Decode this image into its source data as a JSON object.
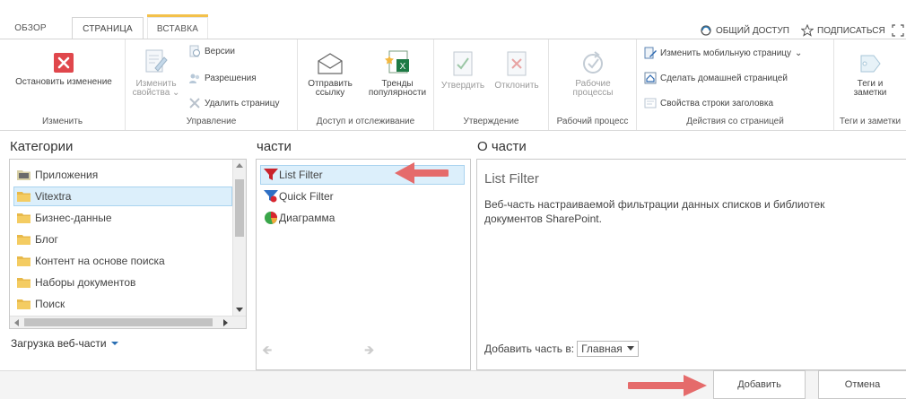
{
  "tabs": [
    {
      "label": "ОБЗОР"
    },
    {
      "label": "СТРАНИЦА"
    },
    {
      "label": "ВСТАВКА"
    }
  ],
  "toplinks": {
    "share": "ОБЩИЙ ДОСТУП",
    "follow": "ПОДПИСАТЬСЯ"
  },
  "ribbon": {
    "edit_group": {
      "label": "Изменить",
      "stop_edit": "Остановить изменение"
    },
    "manage_group": {
      "label": "Управление",
      "edit_props_line1": "Изменить",
      "edit_props_line2": "свойства",
      "versions": "Версии",
      "permissions": "Разрешения",
      "delete_page": "Удалить страницу"
    },
    "share_group": {
      "label": "Доступ и отслеживание",
      "send_link_line1": "Отправить",
      "send_link_line2": "ссылку",
      "trends_line1": "Тренды",
      "trends_line2": "популярности"
    },
    "approve_group": {
      "label": "Утверждение",
      "approve": "Утвердить",
      "reject": "Отклонить"
    },
    "workflow_group": {
      "label": "Рабочий процесс",
      "workflows_line1": "Рабочие",
      "workflows_line2": "процессы"
    },
    "page_actions_group": {
      "label": "Действия со страницей",
      "mobile_page": "Изменить мобильную страницу",
      "make_home": "Сделать домашней страницей",
      "title_bar_props": "Свойства строки заголовка"
    },
    "tags_group": {
      "label": "Теги и заметки",
      "tags_line1": "Теги и",
      "tags_line2": "заметки"
    }
  },
  "categories": {
    "title": "Категории",
    "items": [
      {
        "label": "Приложения"
      },
      {
        "label": "Vitextra"
      },
      {
        "label": "Бизнес-данные"
      },
      {
        "label": "Блог"
      },
      {
        "label": "Контент на основе поиска"
      },
      {
        "label": "Наборы документов"
      },
      {
        "label": "Поиск"
      }
    ],
    "upload": "Загрузка веб-части"
  },
  "parts": {
    "title": "части",
    "items": [
      {
        "label": "List Filter"
      },
      {
        "label": "Quick Filter"
      },
      {
        "label": "Диаграмма"
      }
    ]
  },
  "about": {
    "title": "О части",
    "part_name": "List Filter",
    "description_line1": "Веб-часть настраиваемой фильтрации данных списков и библиотек",
    "description_line2": "документов SharePoint.",
    "add_to_label": "Добавить часть в:",
    "zone_value": "Главная"
  },
  "buttons": {
    "add": "Добавить",
    "cancel": "Отмена"
  },
  "colors": {
    "accent_red": "#e0474c",
    "selection": "#dceffb",
    "arrow": "#e56b6b",
    "insert_tab_bar": "#f3c14b"
  }
}
